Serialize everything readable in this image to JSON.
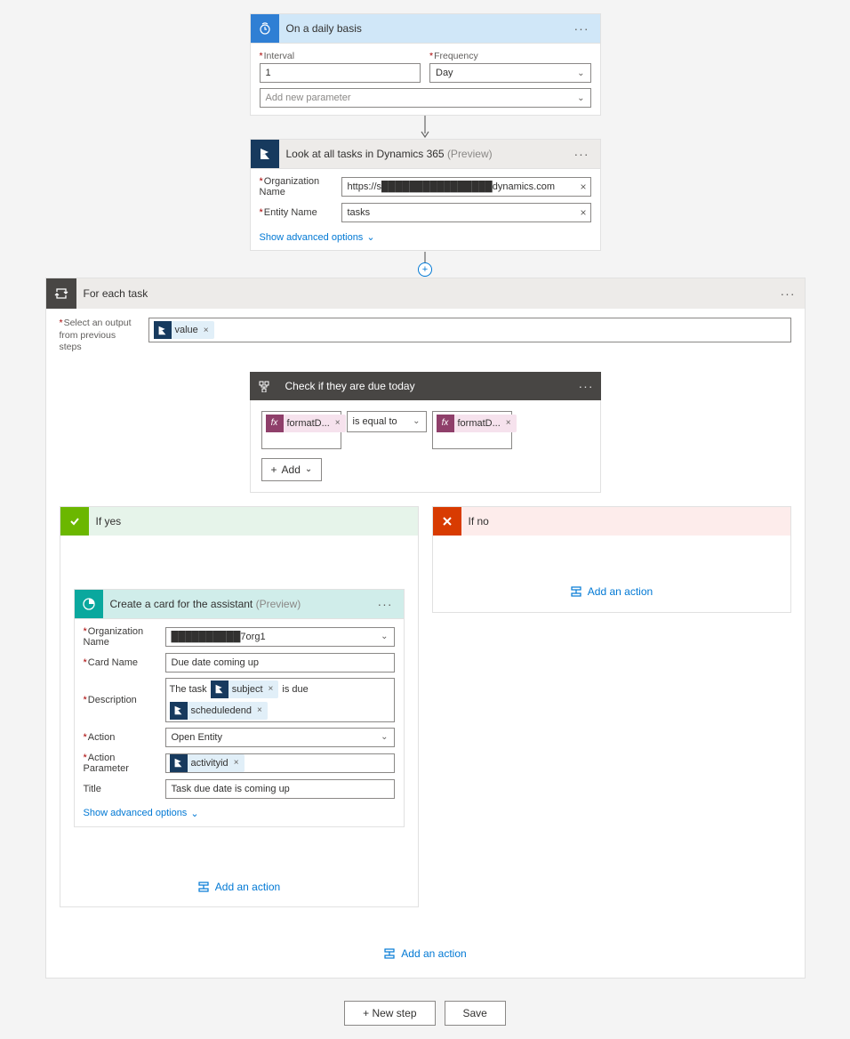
{
  "trigger": {
    "title": "On a daily basis",
    "interval_label": "Interval",
    "interval_value": "1",
    "frequency_label": "Frequency",
    "frequency_value": "Day",
    "add_param": "Add new parameter"
  },
  "lookup": {
    "title": "Look at all tasks in Dynamics 365",
    "preview": "(Preview)",
    "org_label": "Organization Name",
    "org_value": "https://s████████████████dynamics.com",
    "entity_label": "Entity Name",
    "entity_value": "tasks",
    "show_advanced": "Show advanced options"
  },
  "foreach": {
    "title": "For each task",
    "select_label": "Select an output from previous steps",
    "value_pill": "value"
  },
  "condition": {
    "title": "Check if they are due today",
    "left_pill": "formatD...",
    "operator": "is equal to",
    "right_pill": "formatD...",
    "add_label": "Add"
  },
  "branches": {
    "yes_title": "If yes",
    "no_title": "If no"
  },
  "assistant": {
    "title": "Create a card for the assistant",
    "preview": "(Preview)",
    "org_label": "Organization Name",
    "org_value": "██████████7org1",
    "cardname_label": "Card Name",
    "cardname_value": "Due date coming up",
    "desc_label": "Description",
    "desc_prefix": "The task",
    "desc_pill1": "subject",
    "desc_mid": "is due",
    "desc_pill2": "scheduledend",
    "action_label": "Action",
    "action_value": "Open Entity",
    "actionparam_label": "Action Parameter",
    "actionparam_pill": "activityid",
    "title_label": "Title",
    "title_value": "Task due date is coming up",
    "show_advanced": "Show advanced options"
  },
  "actions": {
    "add_action": "Add an action"
  },
  "footer": {
    "new_step": "+ New step",
    "save": "Save"
  }
}
